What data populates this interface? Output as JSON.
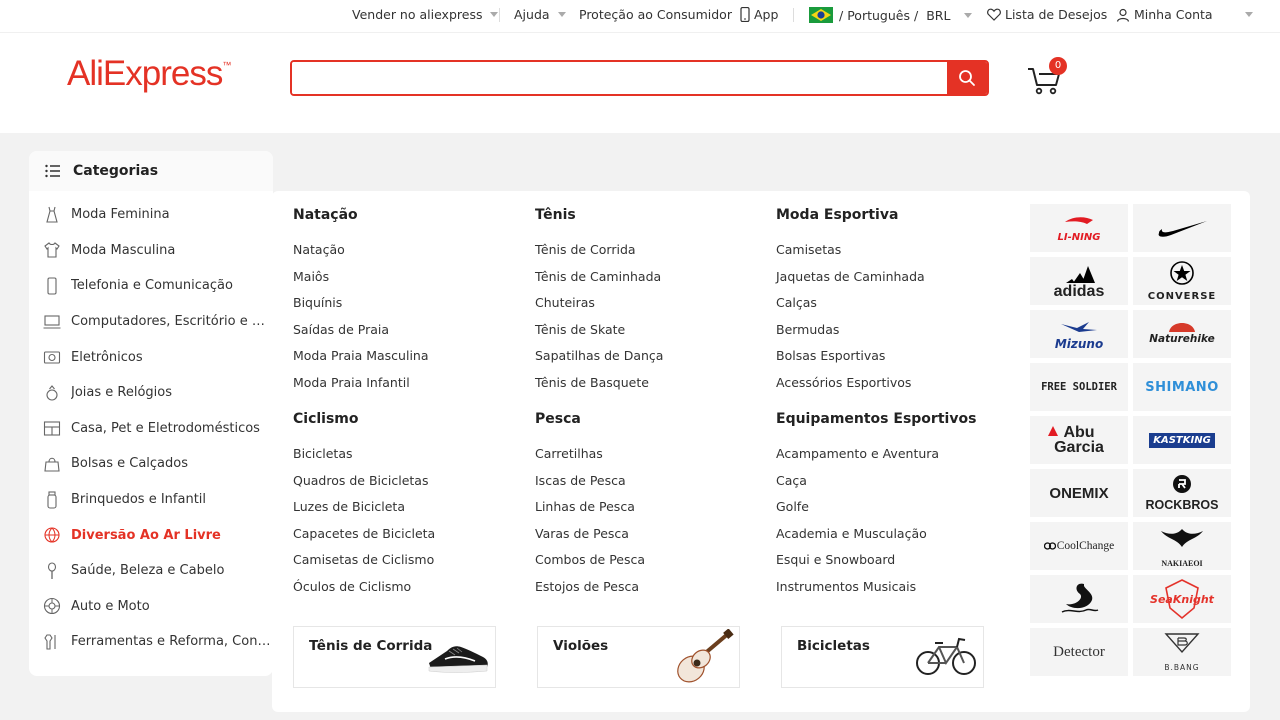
{
  "topbar": {
    "sell": "Vender no aliexpress",
    "help": "Ajuda",
    "protection": "Proteção ao Consumidor",
    "app": "App",
    "lang_sep": "/",
    "language": "Português",
    "lang_sep2": "/",
    "currency": "BRL",
    "wishlist": "Lista de Desejos",
    "account": "Minha Conta"
  },
  "header": {
    "logo": "AliExpress",
    "search": {
      "value": "",
      "placeholder": ""
    },
    "cart_count": "0"
  },
  "categories": {
    "title": "Categorias",
    "items": [
      {
        "label": "Moda Feminina",
        "icon": "dress-icon"
      },
      {
        "label": "Moda Masculina",
        "icon": "shirt-icon"
      },
      {
        "label": "Telefonia e Comunicação",
        "icon": "phone-icon"
      },
      {
        "label": "Computadores, Escritório e Se...",
        "icon": "computer-icon"
      },
      {
        "label": "Eletrônicos",
        "icon": "camera-icon"
      },
      {
        "label": "Joias e Relógios",
        "icon": "ring-icon"
      },
      {
        "label": "Casa, Pet e Eletrodomésticos",
        "icon": "home-icon"
      },
      {
        "label": "Bolsas e Calçados",
        "icon": "bag-icon"
      },
      {
        "label": "Brinquedos e Infantil",
        "icon": "bottle-icon"
      },
      {
        "label": "Diversão Ao Ar Livre",
        "icon": "ball-icon",
        "active": true
      },
      {
        "label": "Saúde, Beleza e Cabelo",
        "icon": "brush-icon"
      },
      {
        "label": "Auto e Moto",
        "icon": "wheel-icon"
      },
      {
        "label": "Ferramentas e Reforma, Const...",
        "icon": "tools-icon"
      }
    ]
  },
  "menu": {
    "columns": [
      {
        "title": "Natação",
        "items": [
          "Natação",
          "Maiôs",
          "Biquínis",
          "Saídas de Praia",
          "Moda Praia Masculina",
          "Moda Praia Infantil"
        ]
      },
      {
        "title": "Tênis",
        "items": [
          "Tênis de Corrida",
          "Tênis de Caminhada",
          "Chuteiras",
          "Tênis de Skate",
          "Sapatilhas de Dança",
          "Tênis de Basquete"
        ]
      },
      {
        "title": "Moda Esportiva",
        "items": [
          "Camisetas",
          "Jaquetas de Caminhada",
          "Calças",
          "Bermudas",
          "Bolsas Esportivas",
          "Acessórios Esportivos"
        ]
      },
      {
        "title": "Ciclismo",
        "items": [
          "Bicicletas",
          "Quadros de Bicicletas",
          "Luzes de Bicicleta",
          "Capacetes de Bicicleta",
          "Camisetas de Ciclismo",
          "Óculos de Ciclismo"
        ]
      },
      {
        "title": "Pesca",
        "items": [
          "Carretilhas",
          "Iscas de Pesca",
          "Linhas de Pesca",
          "Varas de Pesca",
          "Combos de Pesca",
          "Estojos de Pesca"
        ]
      },
      {
        "title": "Equipamentos Esportivos",
        "items": [
          "Acampamento e Aventura",
          "Caça",
          "Golfe",
          "Academia e Musculação",
          "Esqui e Snowboard",
          "Instrumentos Musicais"
        ]
      }
    ],
    "promos": [
      {
        "title": "Tênis de Corrida",
        "image": "sneaker-image"
      },
      {
        "title": "Violões",
        "image": "guitar-image"
      },
      {
        "title": "Bicicletas",
        "image": "bicycle-image"
      }
    ],
    "brands": [
      {
        "name": "LI-NING",
        "color": "#e21b23"
      },
      {
        "name": "",
        "color": "#000000",
        "logo": "nike-swoosh"
      },
      {
        "name": "adidas",
        "color": "#000000"
      },
      {
        "name": "CONVERSE",
        "color": "#000000"
      },
      {
        "name": "Mizuno",
        "color": "#1b3b8f"
      },
      {
        "name": "Naturehike",
        "color": "#222222"
      },
      {
        "name": "FREE SOLDIER",
        "color": "#111111"
      },
      {
        "name": "SHIMANO",
        "color": "#2f8fd8"
      },
      {
        "name": "Abu Garcia",
        "color": "#111111"
      },
      {
        "name": "KASTKING",
        "color": "#1a3d8f"
      },
      {
        "name": "ONEMIX",
        "color": "#111111"
      },
      {
        "name": "ROCKBROS",
        "color": "#111111"
      },
      {
        "name": "CoolChange",
        "color": "#111111"
      },
      {
        "name": "NAKIAEOI",
        "color": "#111111"
      },
      {
        "name": "",
        "color": "#111111",
        "logo": "swan-emblem"
      },
      {
        "name": "SeaKnight",
        "color": "#e4332b"
      },
      {
        "name": "Detector",
        "color": "#333333"
      },
      {
        "name": "B.BANG",
        "color": "#333333"
      }
    ]
  }
}
